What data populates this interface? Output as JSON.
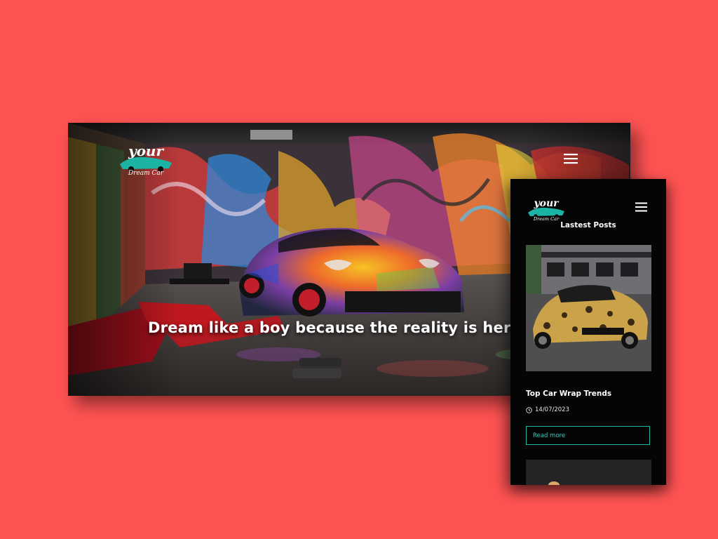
{
  "brand": {
    "logo_text_top": "your",
    "logo_text_bottom": "Dream Car"
  },
  "desktop": {
    "hero_heading": "Dream like a boy because the reality is here",
    "menu_icon": "hamburger-menu-icon"
  },
  "mobile": {
    "section_heading": "Lastest Posts",
    "menu_icon": "hamburger-menu-icon",
    "post": {
      "title": "Top Car Wrap Trends",
      "date": "14/07/2023",
      "date_icon": "clock-icon",
      "read_more_label": "Read more"
    }
  },
  "colors": {
    "background": "#ff5353",
    "accent": "#20b5a6",
    "panel": "#050505",
    "text": "#ffffff"
  }
}
